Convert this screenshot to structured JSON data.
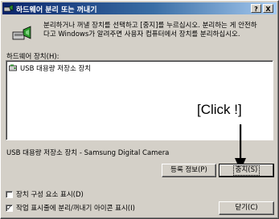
{
  "window": {
    "title": "하드웨어 분리 또는 꺼내기",
    "help_button": "?",
    "close_button": "X"
  },
  "intro": {
    "line1": "분리하거나 꺼낼 장치를 선택하고 [중지]를 누르십시오. 분리하는 게 안전하",
    "line2": "다고 Windows가 알려주면 사용자 컴퓨터에서 장치를 분리하십시오."
  },
  "devices": {
    "label": "하드웨어 장치(H):",
    "items": [
      {
        "label": "USB 대용량 저장소 장치"
      }
    ],
    "description": "USB 대용량 저장소 장치 - Samsung Digital Camera"
  },
  "annotation": {
    "text": "[Click !]"
  },
  "buttons": {
    "properties": "등록 정보(P)",
    "stop": "중지(S)",
    "close": "닫기(C)"
  },
  "options": {
    "show_components": {
      "label": "장치 구성 요소 표시(D)",
      "checked": false
    },
    "show_taskbar_icon": {
      "label": "작업 표시줄에 분리/꺼내기 아이콘 표시(I)",
      "checked": true
    }
  }
}
